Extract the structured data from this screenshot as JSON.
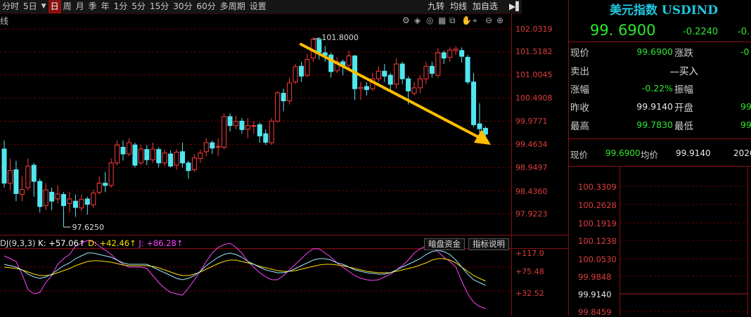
{
  "toolbar": {
    "items": [
      "分时",
      "5日",
      "日",
      "周",
      "月",
      "季",
      "年",
      "1分",
      "5分",
      "15分",
      "30分",
      "60分",
      "多周期",
      "设置"
    ],
    "selected_index": 2,
    "right_items": [
      "九转",
      "均线",
      "加自选"
    ]
  },
  "chart_header": {
    "label": "线"
  },
  "colors": {
    "up": "#ff3c3c",
    "down": "#50e6f0",
    "grid": "#5a0000",
    "k_line": "#ffffff",
    "d_line": "#ffe000",
    "j_line": "#ff44ff",
    "arrow": "#ffbe00"
  },
  "price_axis": {
    "labels": [
      "102.0319",
      "101.5182",
      "101.0045",
      "100.4908",
      "99.9771",
      "99.4634",
      "98.9497",
      "98.4360",
      "97.9223"
    ]
  },
  "annotations": {
    "high": "101.8000",
    "low": "97.6250"
  },
  "indicator": {
    "name": "DJ(9,3,3)",
    "k_label": "K: +57.06↑",
    "d_label": "D: +42.46↑",
    "j_label": "J: +86.28↑",
    "axis_labels": [
      "+117.0",
      "+75.48",
      "+32.52"
    ],
    "buttons": [
      "暗盘资金",
      "指标说明"
    ]
  },
  "chart_data": {
    "type": "candlestick",
    "ylim": [
      97.55,
      102.2
    ],
    "candles": [
      [
        99.36,
        98.6,
        98.5,
        99.55
      ],
      [
        98.6,
        98.88,
        98.45,
        99.15
      ],
      [
        98.9,
        98.37,
        98.2,
        99.1
      ],
      [
        98.35,
        98.46,
        98.2,
        98.75
      ],
      [
        98.5,
        98.98,
        98.45,
        99.15
      ],
      [
        99.0,
        98.64,
        98.3,
        99.05
      ],
      [
        98.64,
        98.08,
        97.95,
        98.7
      ],
      [
        98.1,
        98.45,
        98.0,
        98.6
      ],
      [
        98.4,
        98.2,
        98.0,
        98.5
      ],
      [
        98.25,
        98.36,
        98.15,
        98.55
      ],
      [
        98.35,
        98.1,
        97.625,
        98.4
      ],
      [
        98.15,
        98.25,
        97.95,
        98.4
      ],
      [
        98.2,
        98.06,
        97.85,
        98.35
      ],
      [
        98.05,
        98.24,
        97.98,
        98.35
      ],
      [
        98.25,
        98.13,
        97.9,
        98.3
      ],
      [
        98.12,
        98.38,
        98.05,
        98.45
      ],
      [
        98.4,
        98.6,
        98.35,
        98.75
      ],
      [
        98.6,
        98.55,
        98.4,
        98.85
      ],
      [
        98.55,
        99.05,
        98.5,
        99.15
      ],
      [
        99.05,
        99.45,
        99.0,
        99.55
      ],
      [
        99.4,
        99.25,
        99.1,
        99.55
      ],
      [
        99.25,
        99.5,
        99.2,
        99.6
      ],
      [
        99.45,
        99.0,
        98.95,
        99.5
      ],
      [
        99.05,
        99.36,
        99.0,
        99.45
      ],
      [
        99.35,
        99.12,
        99.0,
        99.45
      ],
      [
        99.12,
        99.36,
        99.05,
        99.5
      ],
      [
        99.35,
        99.05,
        98.95,
        99.4
      ],
      [
        99.05,
        99.27,
        98.98,
        99.35
      ],
      [
        99.25,
        98.98,
        98.95,
        99.33
      ],
      [
        99.0,
        99.29,
        98.9,
        99.35
      ],
      [
        99.3,
        99.05,
        98.95,
        99.5
      ],
      [
        99.05,
        98.88,
        98.7,
        99.1
      ],
      [
        98.9,
        99.16,
        98.85,
        99.25
      ],
      [
        99.15,
        99.27,
        99.05,
        99.35
      ],
      [
        99.3,
        99.5,
        99.2,
        99.6
      ],
      [
        99.5,
        99.38,
        99.25,
        99.55
      ],
      [
        99.4,
        99.42,
        99.2,
        99.6
      ],
      [
        99.4,
        100.08,
        99.35,
        100.15
      ],
      [
        100.08,
        99.88,
        99.75,
        100.15
      ],
      [
        99.88,
        99.97,
        99.8,
        100.1
      ],
      [
        99.98,
        99.79,
        99.7,
        100.05
      ],
      [
        99.8,
        99.88,
        99.6,
        100.05
      ],
      [
        99.88,
        99.88,
        99.7,
        99.98
      ],
      [
        99.9,
        99.65,
        99.5,
        99.95
      ],
      [
        99.7,
        99.51,
        99.45,
        99.8
      ],
      [
        99.5,
        99.98,
        99.45,
        100.05
      ],
      [
        99.98,
        100.61,
        99.95,
        100.65
      ],
      [
        100.6,
        100.43,
        100.2,
        100.7
      ],
      [
        100.43,
        100.83,
        100.35,
        100.95
      ],
      [
        100.85,
        101.19,
        100.8,
        101.25
      ],
      [
        101.2,
        100.98,
        100.85,
        101.3
      ],
      [
        101.0,
        101.35,
        100.95,
        101.48
      ],
      [
        101.38,
        101.8,
        101.3,
        101.85
      ],
      [
        101.8,
        101.51,
        101.35,
        101.8
      ],
      [
        101.5,
        101.44,
        101.3,
        101.65
      ],
      [
        101.45,
        101.08,
        100.95,
        101.5
      ],
      [
        101.1,
        101.3,
        101.05,
        101.4
      ],
      [
        101.3,
        101.22,
        101.0,
        101.35
      ],
      [
        101.22,
        101.43,
        101.15,
        101.55
      ],
      [
        101.43,
        100.7,
        100.45,
        101.45
      ],
      [
        100.7,
        100.73,
        100.45,
        100.85
      ],
      [
        100.75,
        100.68,
        100.55,
        100.85
      ],
      [
        100.7,
        100.92,
        100.65,
        101.05
      ],
      [
        100.92,
        101.09,
        100.85,
        101.2
      ],
      [
        101.09,
        100.98,
        100.85,
        101.25
      ],
      [
        101.0,
        100.8,
        100.65,
        101.05
      ],
      [
        100.8,
        101.25,
        100.7,
        101.38
      ],
      [
        101.25,
        100.92,
        100.8,
        101.3
      ],
      [
        100.92,
        100.65,
        100.35,
        100.98
      ],
      [
        100.6,
        100.72,
        100.55,
        100.85
      ],
      [
        100.72,
        100.92,
        100.6,
        101.0
      ],
      [
        100.92,
        101.2,
        100.8,
        101.3
      ],
      [
        101.2,
        101.04,
        100.95,
        101.3
      ],
      [
        101.0,
        101.5,
        100.95,
        101.6
      ],
      [
        101.5,
        101.38,
        101.25,
        101.55
      ],
      [
        101.4,
        101.56,
        101.3,
        101.62
      ],
      [
        101.55,
        101.58,
        101.45,
        101.65
      ],
      [
        101.55,
        101.42,
        101.28,
        101.62
      ],
      [
        101.4,
        100.85,
        100.8,
        101.45
      ],
      [
        100.85,
        99.9,
        99.85,
        101.05
      ],
      [
        99.92,
        99.81,
        99.72,
        100.38
      ],
      [
        99.82,
        99.69,
        99.5,
        99.86
      ]
    ]
  }
}
